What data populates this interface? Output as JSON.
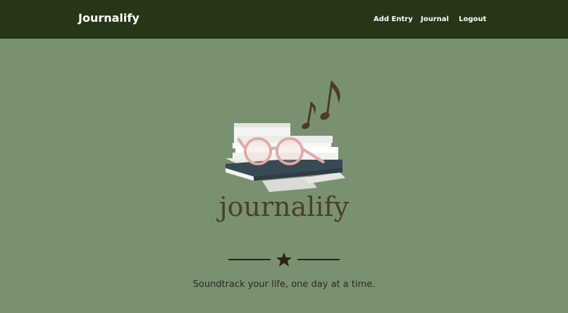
{
  "navbar": {
    "brand": "Journalify",
    "links": [
      {
        "label": "Add Entry"
      },
      {
        "label": "Journal"
      },
      {
        "label": "Logout"
      }
    ]
  },
  "hero": {
    "logo_text": "journalify",
    "tagline": "Soundtrack your life, one day at a time."
  },
  "colors": {
    "navbar_bg": "#283618",
    "page_bg": "#7a9171",
    "logo_text": "#4a3f2c",
    "divider": "#2b2318"
  },
  "icons": {
    "hero": "books-glasses-music-notes-illustration",
    "divider": "star-icon"
  }
}
